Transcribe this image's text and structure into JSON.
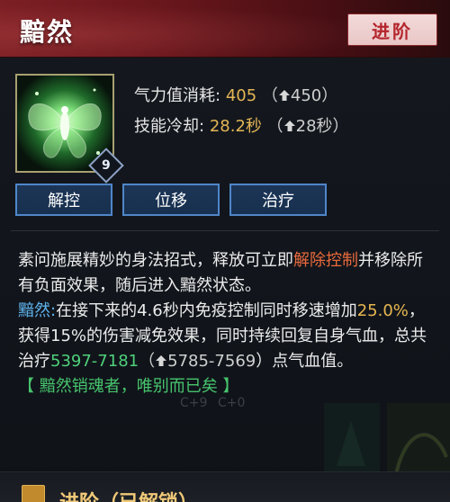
{
  "header": {
    "title": "黯然",
    "advance_label": "进阶"
  },
  "skill": {
    "icon": "butterfly-skill-icon",
    "level": "9",
    "cost_label": "气力值消耗:",
    "cost_value": "405",
    "cost_open": "（",
    "cost_upgrade": "450",
    "cost_close": "）",
    "cooldown_label": "技能冷却:",
    "cooldown_value": "28.2秒",
    "cooldown_open": "（",
    "cooldown_upgrade": "28秒",
    "cooldown_close": "）"
  },
  "tags": [
    "解控",
    "位移",
    "治疗"
  ],
  "description": {
    "p1_a": "素问施展精妙的身法招式，释放可立即",
    "p1_highlight": "解除控制",
    "p1_b": "并移除所有负面效果，随后进入黯然状态。",
    "state_name": "黯然:",
    "p2_a": "在接下来的4.6秒内免疫控制同时移速增加",
    "p2_speed": "25.0%",
    "p2_b": "，获得15%的伤害减免效果，同时持续回复自身气血，总共治疗",
    "p2_heal": "5397-7181",
    "p2_open": "（",
    "p2_upgrade": "5785-7569",
    "p2_close": "）点气血值。",
    "motto": "【 黯然销魂者，唯别而已矣 】"
  },
  "footer": {
    "title": "进阶（已解锁）"
  },
  "colors": {
    "header_red": "#7c1f24",
    "gold": "#e4b656",
    "orange": "#ea6a3c",
    "blue": "#5fb4ee",
    "green": "#4fd07a",
    "tag_border": "#4f86c9"
  }
}
